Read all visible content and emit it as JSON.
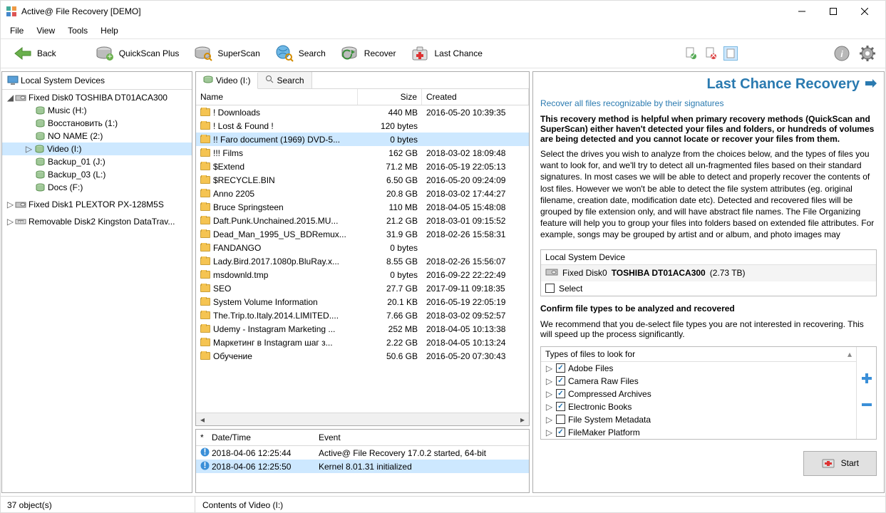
{
  "window": {
    "title": "Active@ File Recovery [DEMO]"
  },
  "menu": [
    "File",
    "View",
    "Tools",
    "Help"
  ],
  "toolbar": {
    "back": "Back",
    "quickscan": "QuickScan Plus",
    "superscan": "SuperScan",
    "search": "Search",
    "recover": "Recover",
    "lastchance": "Last Chance"
  },
  "tree": {
    "header": "Local System Devices",
    "disk0": "Fixed Disk0 TOSHIBA DT01ACA300",
    "vols": [
      {
        "label": "Music (H:)"
      },
      {
        "label": "Восстановить (1:)"
      },
      {
        "label": "NO NAME (2:)"
      },
      {
        "label": "Video (I:)",
        "sel": true
      },
      {
        "label": "Backup_01 (J:)"
      },
      {
        "label": "Backup_03 (L:)"
      },
      {
        "label": "Docs (F:)"
      }
    ],
    "disk1": "Fixed Disk1 PLEXTOR PX-128M5S",
    "disk2": "Removable Disk2 Kingston DataTrav..."
  },
  "tabs": {
    "video": "Video (I:)",
    "search": "Search"
  },
  "cols": {
    "name": "Name",
    "size": "Size",
    "created": "Created"
  },
  "files": [
    {
      "n": "! Downloads",
      "s": "440 MB",
      "c": "2016-05-20 10:39:35"
    },
    {
      "n": "! Lost & Found !",
      "s": "120 bytes",
      "c": ""
    },
    {
      "n": "!! Faro document (1969) DVD-5...",
      "s": "0 bytes",
      "c": "",
      "sel": true
    },
    {
      "n": "!!! Films",
      "s": "162 GB",
      "c": "2018-03-02 18:09:48"
    },
    {
      "n": "$Extend",
      "s": "71.2 MB",
      "c": "2016-05-19 22:05:13"
    },
    {
      "n": "$RECYCLE.BIN",
      "s": "6.50 GB",
      "c": "2016-05-20 09:24:09"
    },
    {
      "n": "Anno 2205",
      "s": "20.8 GB",
      "c": "2018-03-02 17:44:27"
    },
    {
      "n": "Bruce Springsteen",
      "s": "110 MB",
      "c": "2018-04-05 15:48:08"
    },
    {
      "n": "Daft.Punk.Unchained.2015.MU...",
      "s": "21.2 GB",
      "c": "2018-03-01 09:15:52"
    },
    {
      "n": "Dead_Man_1995_US_BDRemux...",
      "s": "31.9 GB",
      "c": "2018-02-26 15:58:31"
    },
    {
      "n": "FANDANGO",
      "s": "0 bytes",
      "c": ""
    },
    {
      "n": "Lady.Bird.2017.1080p.BluRay.x...",
      "s": "8.55 GB",
      "c": "2018-02-26 15:56:07"
    },
    {
      "n": "msdownld.tmp",
      "s": "0 bytes",
      "c": "2016-09-22 22:22:49"
    },
    {
      "n": "SEO",
      "s": "27.7 GB",
      "c": "2017-09-11 09:18:35"
    },
    {
      "n": "System Volume Information",
      "s": "20.1 KB",
      "c": "2016-05-19 22:05:19"
    },
    {
      "n": "The.Trip.to.Italy.2014.LIMITED....",
      "s": "7.66 GB",
      "c": "2018-03-02 09:52:57"
    },
    {
      "n": "Udemy - Instagram Marketing ...",
      "s": "252 MB",
      "c": "2018-04-05 10:13:38"
    },
    {
      "n": "Маркетинг в Instagram шаг з...",
      "s": "2.22 GB",
      "c": "2018-04-05 10:13:24"
    },
    {
      "n": "Обучение",
      "s": "50.6 GB",
      "c": "2016-05-20 07:30:43"
    }
  ],
  "log": {
    "cols": {
      "star": "*",
      "date": "Date/Time",
      "event": "Event"
    },
    "rows": [
      {
        "d": "2018-04-06 12:25:44",
        "e": "Active@ File Recovery 17.0.2 started, 64-bit"
      },
      {
        "d": "2018-04-06 12:25:50",
        "e": "Kernel 8.01.31 initialized",
        "sel": true
      }
    ]
  },
  "right": {
    "title": "Last Chance Recovery",
    "sub": "Recover all files recognizable by their signatures",
    "p1": "This recovery method is helpful when primary recovery methods (QuickScan and SuperScan) either haven't detected your files and folders, or hundreds of volumes are being detected and you cannot locate or recover your files from them.",
    "p2": "Select the drives you wish to analyze from the choices below, and the types of files you want to look for, and we'll try to detect all un-fragmented files based on their standard signatures. In most cases we will be able to detect and properly recover the contents of lost files. However we won't be able to detect the file system attributes (eg. original filename, creation date, modification date etc). Detected and recovered files will be grouped by file extension only, and will have abstract file names. The File Organizing feature will help you to group your files into folders based on extended file attributes. For example, songs may be grouped by artist and or album, and photo images may",
    "deviceHeader": "Local System Device",
    "device": "Fixed Disk0",
    "deviceModel": "TOSHIBA DT01ACA300",
    "deviceSize": "(2.73 TB)",
    "select": "Select",
    "confirm": "Confirm file types to be analyzed and recovered",
    "note": "We recommend that you de-select file types you are not interested in recovering. This will speed up the process significantly.",
    "typesHeader": "Types of files to look for",
    "types": [
      {
        "l": "Adobe Files",
        "c": true
      },
      {
        "l": "Camera Raw Files",
        "c": true
      },
      {
        "l": "Compressed Archives",
        "c": true
      },
      {
        "l": "Electronic Books",
        "c": true
      },
      {
        "l": "File System Metadata",
        "c": false
      },
      {
        "l": "FileMaker Platform",
        "c": true
      }
    ],
    "start": "Start"
  },
  "status": {
    "left": "37 object(s)",
    "center": "Contents of Video (I:)"
  }
}
